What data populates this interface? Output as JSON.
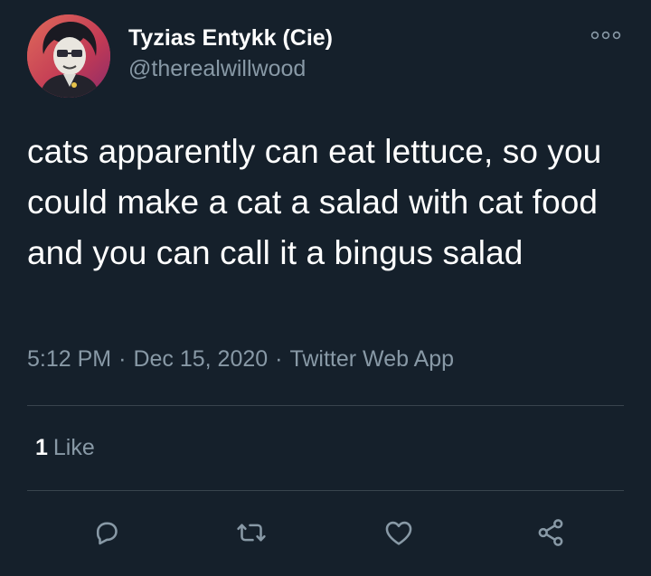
{
  "author": {
    "name": "Tyzias Entykk (Cie)",
    "handle": "@therealwillwood",
    "avatar_icon": "avatar-image"
  },
  "tweet": {
    "text": "cats apparently can eat lettuce, so you could make a cat a salad with cat food and you can call it a bingus salad",
    "time": "5:12 PM",
    "date": "Dec 15, 2020",
    "source": "Twitter Web App",
    "separator": "·"
  },
  "stats": {
    "likes_count": "1",
    "likes_label": "Like"
  },
  "actions": {
    "reply_icon": "reply-icon",
    "retweet_icon": "retweet-icon",
    "like_icon": "heart-icon",
    "share_icon": "share-icon",
    "more_icon": "more-icon"
  },
  "colors": {
    "background": "#15202b",
    "primary_text": "#ffffff",
    "secondary_text": "#8899a6",
    "divider": "#38444d"
  }
}
